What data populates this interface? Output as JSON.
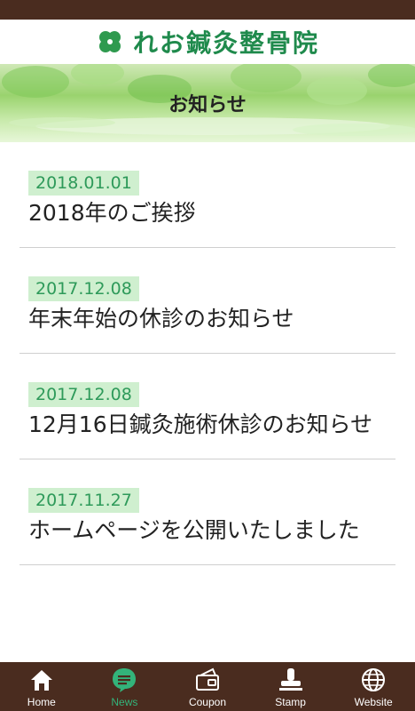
{
  "header": {
    "brand": "れお鍼灸整骨院",
    "page_title": "お知らせ"
  },
  "news": [
    {
      "date": "2018.01.01",
      "title": "2018年のご挨拶"
    },
    {
      "date": "2017.12.08",
      "title": "年末年始の休診のお知らせ"
    },
    {
      "date": "2017.12.08",
      "title": "12月16日鍼灸施術休診のお知らせ"
    },
    {
      "date": "2017.11.27",
      "title": "ホームページを公開いたしました"
    }
  ],
  "tabs": [
    {
      "label": "Home",
      "icon": "home-icon"
    },
    {
      "label": "News",
      "icon": "news-icon",
      "active": true
    },
    {
      "label": "Coupon",
      "icon": "coupon-icon"
    },
    {
      "label": "Stamp",
      "icon": "stamp-icon"
    },
    {
      "label": "Website",
      "icon": "globe-icon"
    }
  ],
  "colors": {
    "bar": "#4a2c1f",
    "accent_green": "#33b37a",
    "date_bg": "#cfefcf",
    "date_text": "#2e9a5a"
  }
}
